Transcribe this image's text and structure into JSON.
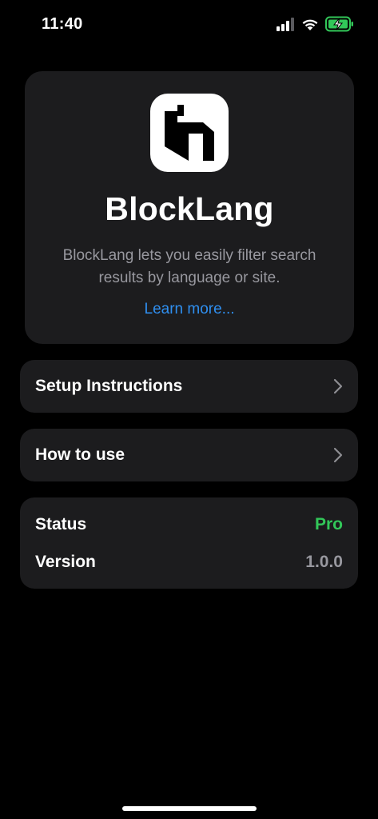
{
  "status_bar": {
    "time": "11:40",
    "icons": [
      "cellular-signal-icon",
      "wifi-icon",
      "battery-charging-icon"
    ]
  },
  "header": {
    "app_name": "BlockLang",
    "description": "BlockLang lets you easily filter search results by language or site.",
    "learn_more": "Learn more...",
    "icon": "blocklang-logo-icon"
  },
  "nav": {
    "items": [
      {
        "label": "Setup Instructions",
        "icon": "chevron-right-icon"
      },
      {
        "label": "How to use",
        "icon": "chevron-right-icon"
      }
    ]
  },
  "info": {
    "rows": [
      {
        "label": "Status",
        "value": "Pro"
      },
      {
        "label": "Version",
        "value": "1.0.0"
      }
    ]
  },
  "colors": {
    "background": "#000000",
    "card": "#1c1c1e",
    "secondary_text": "#98989f",
    "link": "#2f8ff0",
    "pro_green": "#32c759",
    "battery_green": "#32c759"
  }
}
